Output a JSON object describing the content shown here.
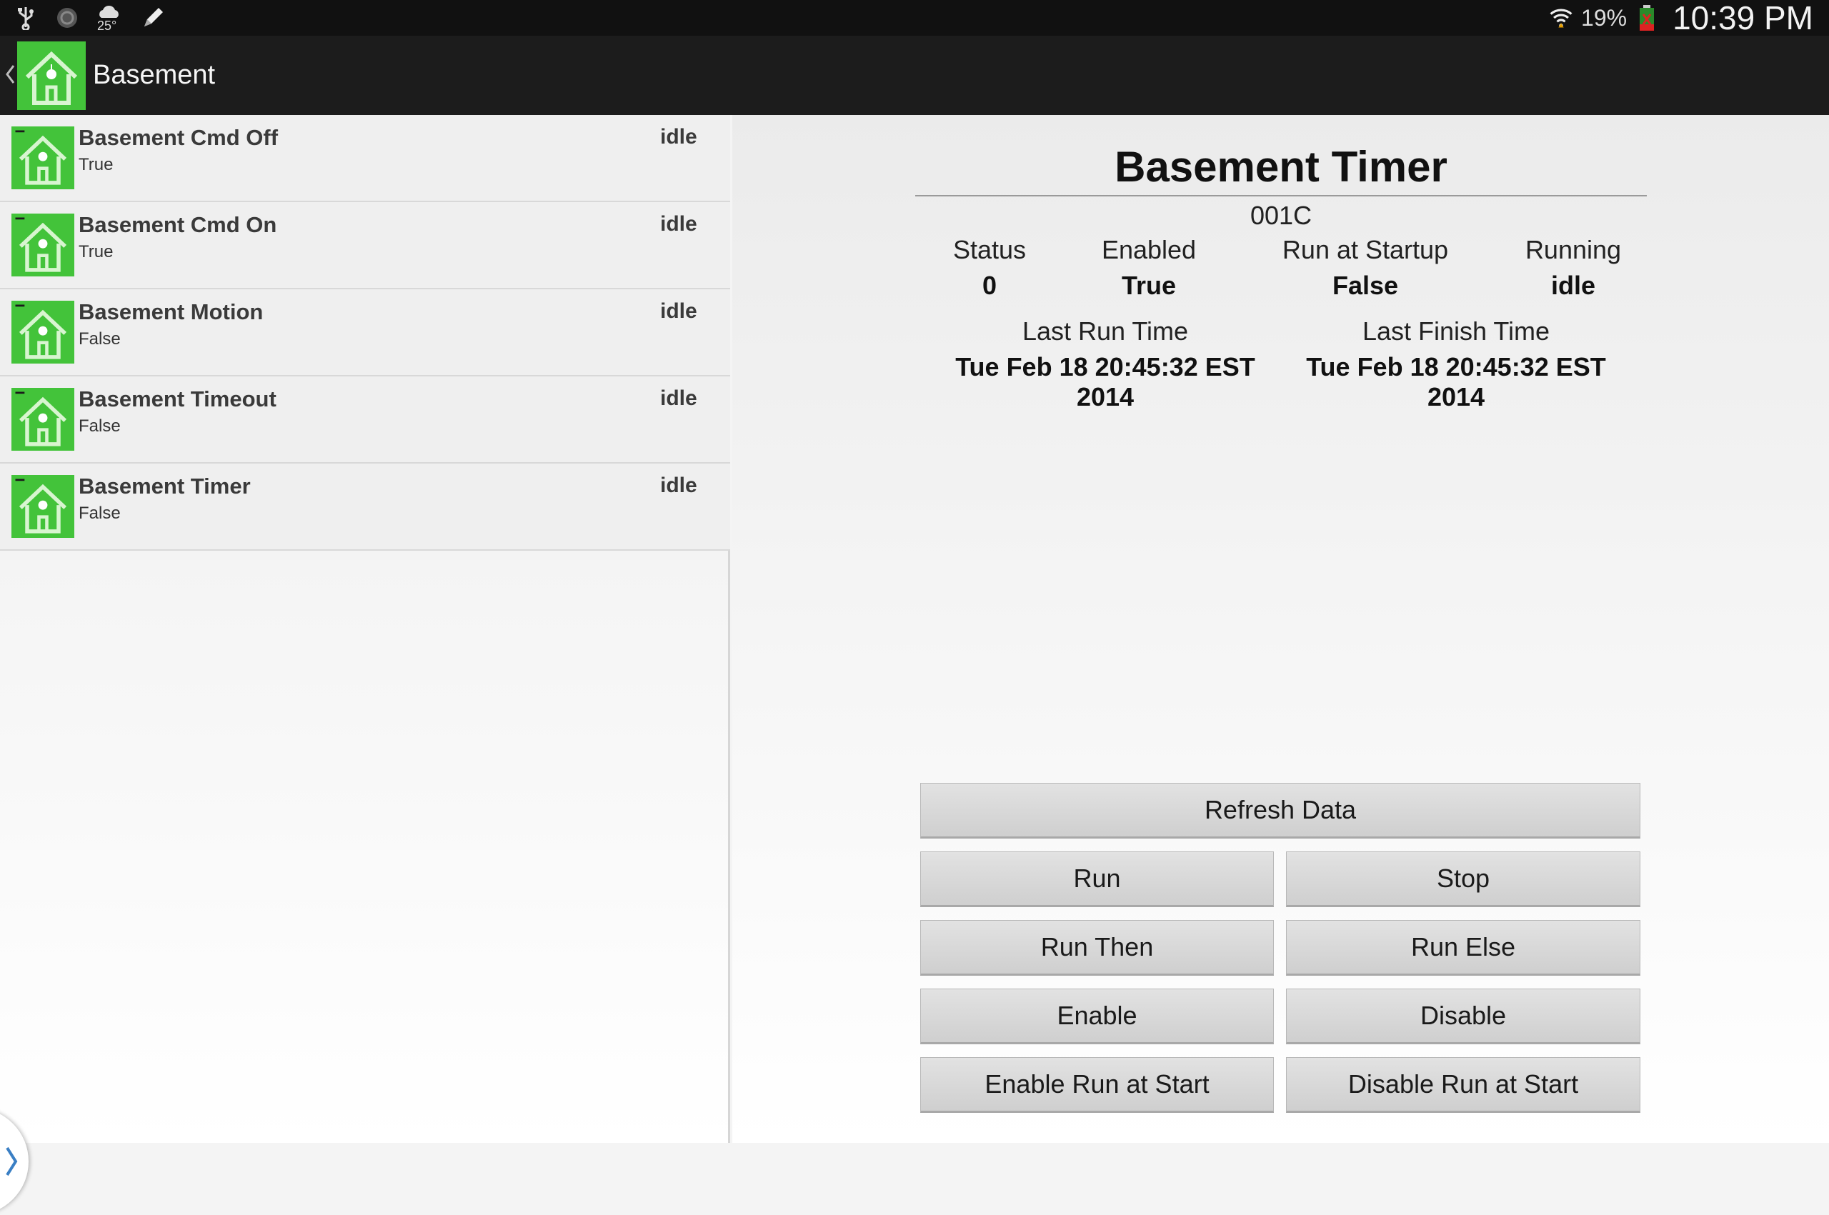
{
  "status_bar": {
    "temperature": "25°",
    "battery_percent": "19%",
    "time": "10:39 PM",
    "icons": [
      "usb-icon",
      "sync-icon",
      "weather-icon",
      "edit-icon",
      "wifi-icon",
      "battery-icon"
    ]
  },
  "action_bar": {
    "title": "Basement"
  },
  "list": {
    "items": [
      {
        "name": "Basement Cmd Off",
        "value": "True",
        "state": "idle"
      },
      {
        "name": "Basement Cmd On",
        "value": "True",
        "state": "idle"
      },
      {
        "name": "Basement Motion",
        "value": "False",
        "state": "idle"
      },
      {
        "name": "Basement Timeout",
        "value": "False",
        "state": "idle"
      },
      {
        "name": "Basement Timer",
        "value": "False",
        "state": "idle"
      }
    ]
  },
  "detail": {
    "title": "Basement Timer",
    "id": "001C",
    "stats": {
      "status": {
        "label": "Status",
        "value": "0"
      },
      "enabled": {
        "label": "Enabled",
        "value": "True"
      },
      "run_at_startup": {
        "label": "Run at Startup",
        "value": "False"
      },
      "running": {
        "label": "Running",
        "value": "idle"
      }
    },
    "last_run": {
      "label": "Last Run Time",
      "value_line1": "Tue Feb 18 20:45:32 EST",
      "value_line2": "2014"
    },
    "last_finish": {
      "label": "Last Finish Time",
      "value_line1": "Tue Feb 18 20:45:32 EST",
      "value_line2": "2014"
    },
    "buttons": {
      "refresh": "Refresh Data",
      "run": "Run",
      "stop": "Stop",
      "run_then": "Run Then",
      "run_else": "Run Else",
      "enable": "Enable",
      "disable": "Disable",
      "enable_run_at_start": "Enable Run at Start",
      "disable_run_at_start": "Disable Run at Start"
    }
  },
  "colors": {
    "status_bar_bg": "#111111",
    "action_bar_bg": "#1c1c1c",
    "icon_green": "#4cc83c",
    "drawer_arrow": "#3a7fc4"
  }
}
